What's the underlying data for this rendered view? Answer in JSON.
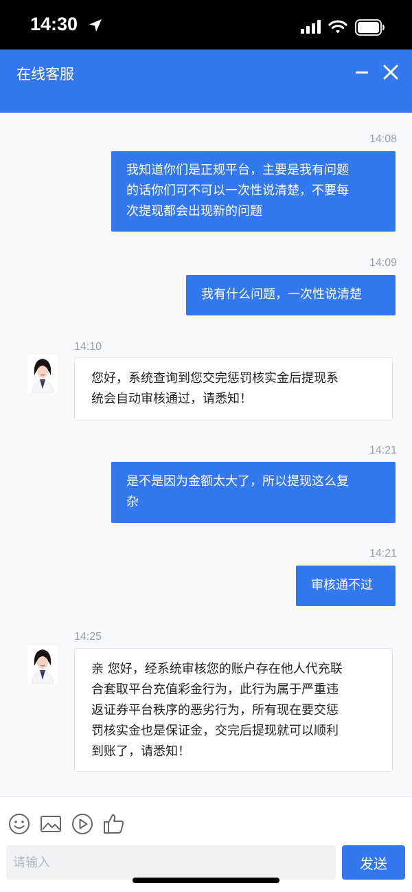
{
  "status_bar": {
    "time": "14:30"
  },
  "header": {
    "title": "在线客服"
  },
  "messages": [
    {
      "sender": "user",
      "time": "14:08",
      "lines": [
        "我知道你们是正规平台，主要是我有问题",
        "的话你们可不可以一次性说清楚，不要每",
        "次提现都会出现新的问题"
      ]
    },
    {
      "sender": "user",
      "time": "14:09",
      "lines": [
        "我有什么问题，一次性说清楚"
      ]
    },
    {
      "sender": "agent",
      "time": "14:10",
      "lines": [
        "您好，系统查询到您交完惩罚核实金后提现系",
        "统会自动审核通过，请悉知！"
      ]
    },
    {
      "sender": "user",
      "time": "14:21",
      "lines": [
        "是不是因为金额太大了，所以提现这么复",
        "杂"
      ]
    },
    {
      "sender": "user",
      "time": "14:21",
      "lines": [
        "审核通不过"
      ]
    },
    {
      "sender": "agent",
      "time": "14:25",
      "lines": [
        "亲 您好，经系统审核您的账户存在他人代充联",
        "合套取平台充值彩金行为，此行为属于严重违",
        "返证券平台秩序的恶劣行为，所有现在要交惩",
        "罚核实金也是保证金，交完后提现就可以顺利",
        "到账了，请悉知！"
      ]
    }
  ],
  "composer": {
    "placeholder": "请输入",
    "send_label": "发送",
    "tools": [
      "emoji-icon",
      "image-icon",
      "video-icon",
      "thumbs-up-icon"
    ]
  },
  "colors": {
    "brand": "#3478f0",
    "chat_bg": "#f8f9fb"
  }
}
